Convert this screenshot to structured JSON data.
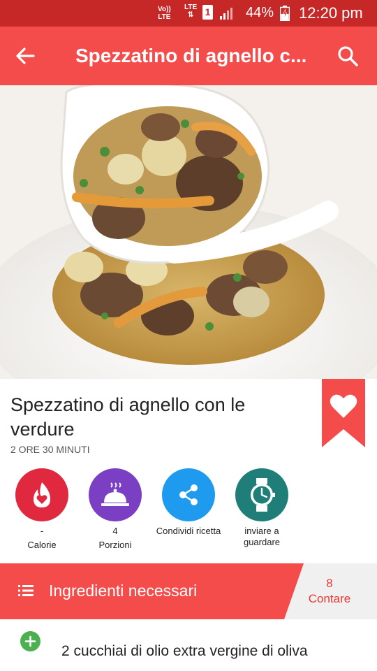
{
  "status_bar": {
    "volte": "Vo))\nLTE",
    "lte": "LTE\n⇅",
    "sim": "1",
    "battery_percent": "44%",
    "time": "12:20 pm"
  },
  "app_bar": {
    "title": "Spezzatino di agnello c...",
    "back_icon": "arrow-left-icon",
    "search_icon": "search-icon",
    "color": "#f44b4b"
  },
  "recipe": {
    "title": "Spezzatino di agnello con le verdure",
    "time": "2 ORE 30 MINUTI"
  },
  "actions": [
    {
      "value": "-",
      "label": "Calorie",
      "icon": "flame-icon",
      "color": "#e0283e"
    },
    {
      "value": "4",
      "label": "Porzioni",
      "icon": "serving-dish-icon",
      "color": "#7b3fc4"
    },
    {
      "label": "Condividi ricetta",
      "icon": "share-icon",
      "color": "#1e9bef"
    },
    {
      "label": "inviare a guardare",
      "icon": "watch-icon",
      "color": "#1f7f78"
    }
  ],
  "ingredients": {
    "header": "Ingredienti necessari",
    "count": "8",
    "count_label": "Contare",
    "items": [
      {
        "text": "2 cucchiai di olio extra vergine di oliva"
      }
    ]
  }
}
